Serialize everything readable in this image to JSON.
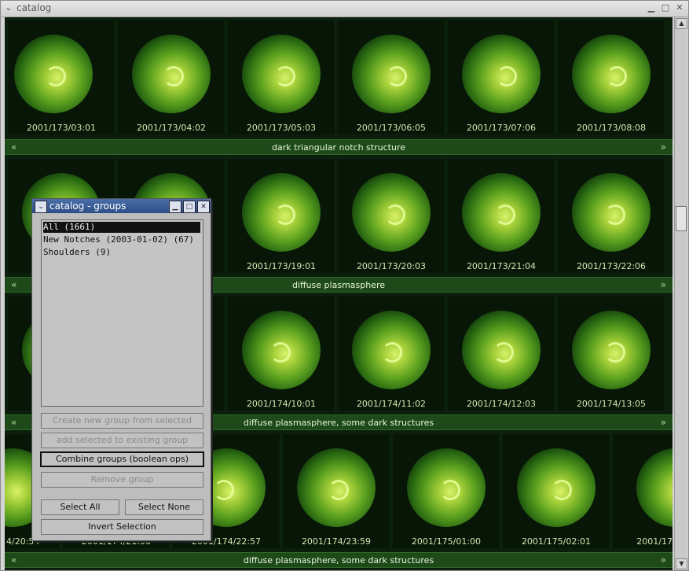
{
  "window": {
    "title": "catalog"
  },
  "rows": [
    {
      "label": "dark triangular notch structure",
      "items": [
        "2001/173/03:01",
        "2001/173/04:02",
        "2001/173/05:03",
        "2001/173/06:05",
        "2001/173/07:06",
        "2001/173/08:08"
      ]
    },
    {
      "label": "diffuse plasmasphere",
      "items": [
        "",
        "",
        "2001/173/19:01",
        "2001/173/20:03",
        "2001/173/21:04",
        "2001/173/22:06"
      ]
    },
    {
      "label": "diffuse plasmasphere, some dark structures",
      "items": [
        "",
        "",
        "2001/174/10:01",
        "2001/174/11:02",
        "2001/174/12:03",
        "2001/174/13:05"
      ]
    },
    {
      "label": "diffuse plasmasphere, some dark structures",
      "items": [
        "4/20:54",
        "2001/174/21:56",
        "2001/174/22:57",
        "2001/174/23:59",
        "2001/175/01:00",
        "2001/175/02:01",
        "2001/17"
      ]
    }
  ],
  "nav": {
    "prev": "«",
    "next": "»"
  },
  "dialog": {
    "title": "catalog - groups",
    "groups": [
      "All (1661)",
      "New Notches (2003-01-02) (67)",
      "Shoulders (9)"
    ],
    "buttons": {
      "create": "Create new group from selected",
      "add": "add selected to existing group",
      "combine": "Combine groups (boolean ops)",
      "remove": "Remove group",
      "select_all": "Select All",
      "select_none": "Select None",
      "invert": "Invert Selection"
    }
  }
}
